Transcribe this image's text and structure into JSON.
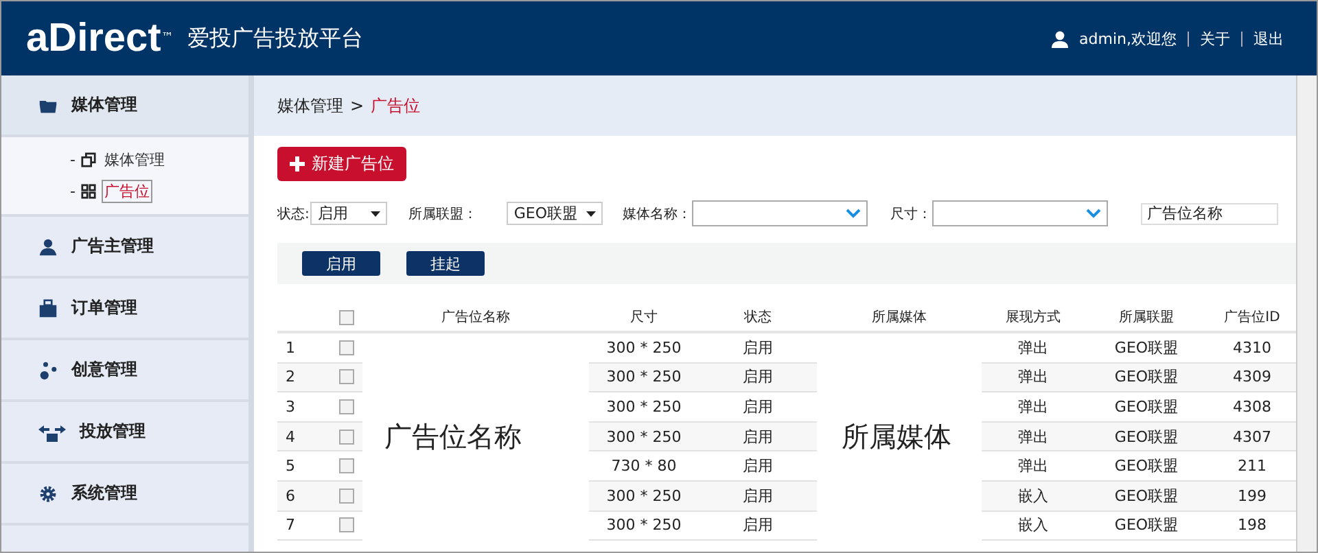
{
  "header": {
    "logo": "aDirect",
    "trademark": "™",
    "platform": "爱投广告投放平台",
    "user": "admin,欢迎您",
    "links": [
      "关于",
      "退出"
    ]
  },
  "sidebar": {
    "items": [
      {
        "label": "媒体管理",
        "expanded": true,
        "children": [
          {
            "marker": "-",
            "label": "媒体管理",
            "selected": false
          },
          {
            "marker": "-",
            "label": "广告位",
            "selected": true
          }
        ]
      },
      {
        "label": "广告主管理"
      },
      {
        "label": "订单管理"
      },
      {
        "label": "创意管理"
      },
      {
        "label": "投放管理"
      },
      {
        "label": "系统管理"
      }
    ]
  },
  "breadcrumb": {
    "parent": "媒体管理",
    "separator": ">",
    "current": "广告位"
  },
  "new_button": "新建广告位",
  "filters": [
    {
      "kind": "select",
      "label": "状态:",
      "value": "启用"
    },
    {
      "kind": "select",
      "label": "所属联盟：",
      "value": "GEO联盟"
    },
    {
      "kind": "combo",
      "label": "媒体名称："
    },
    {
      "kind": "combo",
      "label": "尺寸："
    },
    {
      "kind": "text",
      "placeholder": "广告位名称"
    }
  ],
  "actions": [
    "启用",
    "挂起"
  ],
  "table": {
    "columns": [
      "广告位名称",
      "尺寸",
      "状态",
      "所属媒体",
      "展现方式",
      "所属联盟",
      "广告位ID"
    ],
    "all_checked": false,
    "name_overlay": "广告位名称",
    "media_overlay": "所属媒体",
    "rows": [
      {
        "index": "1",
        "checked": false,
        "size": "300 * 250",
        "status": "启用",
        "display": "弹出",
        "alliance": "GEO联盟",
        "id": "4310"
      },
      {
        "index": "2",
        "checked": false,
        "size": "300 * 250",
        "status": "启用",
        "display": "弹出",
        "alliance": "GEO联盟",
        "id": "4309"
      },
      {
        "index": "3",
        "checked": false,
        "size": "300 * 250",
        "status": "启用",
        "display": "弹出",
        "alliance": "GEO联盟",
        "id": "4308"
      },
      {
        "index": "4",
        "checked": false,
        "size": "300 * 250",
        "status": "启用",
        "display": "弹出",
        "alliance": "GEO联盟",
        "id": "4307"
      },
      {
        "index": "5",
        "checked": false,
        "size": "730 * 80",
        "status": "启用",
        "display": "弹出",
        "alliance": "GEO联盟",
        "id": "211"
      },
      {
        "index": "6",
        "checked": false,
        "size": "300 * 250",
        "status": "启用",
        "display": "嵌入",
        "alliance": "GEO联盟",
        "id": "199"
      },
      {
        "index": "7",
        "checked": false,
        "size": "300 * 250",
        "status": "启用",
        "display": "嵌入",
        "alliance": "GEO联盟",
        "id": "198"
      }
    ]
  }
}
